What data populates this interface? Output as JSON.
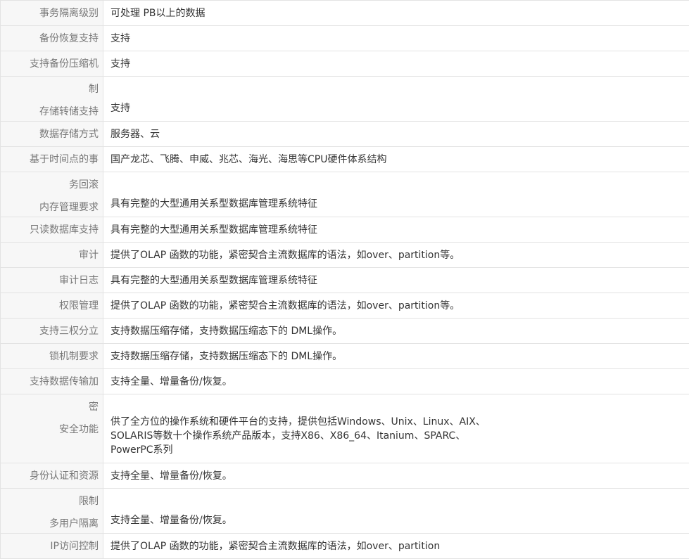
{
  "rows": [
    {
      "label": [
        "事务隔离级别"
      ],
      "value": [
        "可处理 PB以上的数据"
      ]
    },
    {
      "label": [
        "备份恢复支持"
      ],
      "value": [
        "支持"
      ]
    },
    {
      "label": [
        "支持备份压缩机"
      ],
      "value": [
        "支持"
      ]
    },
    {
      "label": [
        "制",
        "存储转储支持"
      ],
      "value": [
        "支持"
      ]
    },
    {
      "label": [
        "数据存储方式"
      ],
      "value": [
        "服务器、云"
      ]
    },
    {
      "label": [
        "基于时间点的事"
      ],
      "value": [
        "国产龙芯、飞腾、申威、兆芯、海光、海思等CPU硬件体系结构"
      ]
    },
    {
      "label": [
        "务回滚",
        "内存管理要求"
      ],
      "value": [
        "具有完整的大型通用关系型数据库管理系统特征"
      ]
    },
    {
      "label": [
        "只读数据库支持"
      ],
      "value": [
        "具有完整的大型通用关系型数据库管理系统特征"
      ]
    },
    {
      "label": [
        "审计"
      ],
      "value": [
        "提供了OLAP 函数的功能，紧密契合主流数据库的语法，如over、partition等。"
      ]
    },
    {
      "label": [
        "审计日志"
      ],
      "value": [
        "具有完整的大型通用关系型数据库管理系统特征"
      ]
    },
    {
      "label": [
        "权限管理"
      ],
      "value": [
        "提供了OLAP 函数的功能，紧密契合主流数据库的语法，如over、partition等。"
      ]
    },
    {
      "label": [
        "支持三权分立"
      ],
      "value": [
        "支持数据压缩存储，支持数据压缩态下的 DML操作。"
      ]
    },
    {
      "label": [
        "锁机制要求"
      ],
      "value": [
        "支持数据压缩存储，支持数据压缩态下的 DML操作。"
      ]
    },
    {
      "label": [
        "支持数据传输加"
      ],
      "value": [
        "支持全量、增量备份/恢复。"
      ]
    },
    {
      "label": [
        "密",
        "安全功能"
      ],
      "value": [
        "供了全方位的操作系统和硬件平台的支持，提供包括Windows、Unix、Linux、AIX、",
        "SOLARIS等数十个操作系统产品版本，支持X86、X86_64、Itanium、SPARC、",
        "PowerPC系列"
      ]
    },
    {
      "label": [
        "身份认证和资源"
      ],
      "value": [
        "支持全量、增量备份/恢复。"
      ]
    },
    {
      "label": [
        "限制",
        "多用户隔离"
      ],
      "value": [
        "支持全量、增量备份/恢复。"
      ]
    },
    {
      "label": [
        "IP访问控制"
      ],
      "value": [
        "提供了OLAP 函数的功能，紧密契合主流数据库的语法，如over、partition"
      ]
    }
  ]
}
